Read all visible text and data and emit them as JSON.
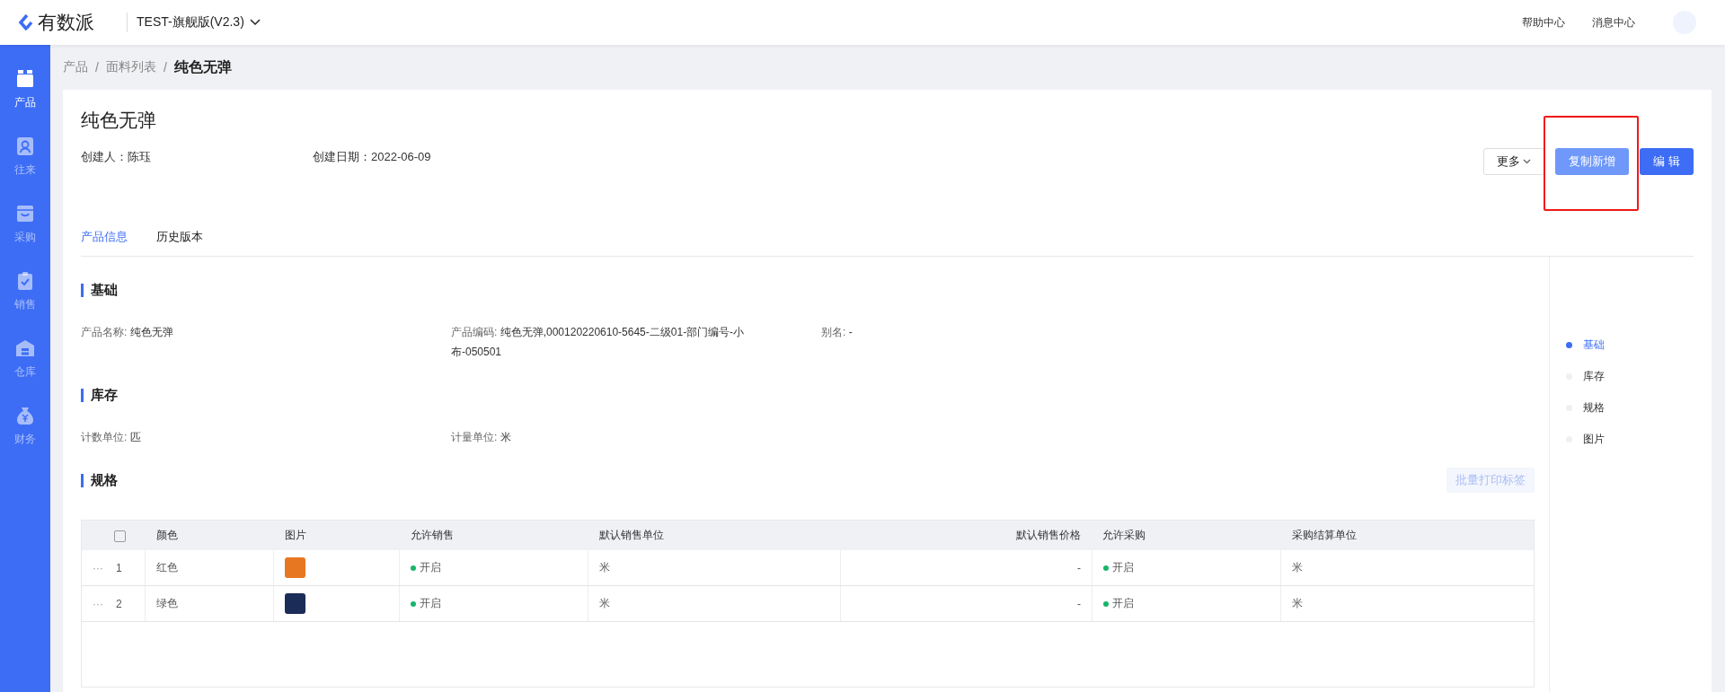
{
  "header": {
    "logo": "有数派",
    "workspace": "TEST-旗舰版(V2.3)",
    "links": [
      "帮助中心",
      "消息中心"
    ]
  },
  "sidebar": {
    "items": [
      {
        "label": "产品",
        "selected": true
      },
      {
        "label": "往来",
        "selected": false
      },
      {
        "label": "采购",
        "selected": false
      },
      {
        "label": "销售",
        "selected": false
      },
      {
        "label": "仓库",
        "selected": false
      },
      {
        "label": "财务",
        "selected": false
      }
    ]
  },
  "breadcrumb": {
    "separator": "/",
    "items": [
      "产品",
      "面料列表",
      "纯色无弹"
    ]
  },
  "title": "纯色无弹",
  "meta": [
    {
      "label": "创建人：",
      "value": "陈珏"
    },
    {
      "label": "创建日期：",
      "value": "2022-06-09"
    }
  ],
  "actions": [
    {
      "label": "更多",
      "kind": "dropdown",
      "highlighted": false
    },
    {
      "label": "复制新增",
      "kind": "light",
      "highlighted": true
    },
    {
      "label": "编 辑",
      "kind": "primary",
      "highlighted": false
    }
  ],
  "tabs": [
    {
      "label": "产品信息",
      "selected": true
    },
    {
      "label": "历史版本",
      "selected": false
    }
  ],
  "sections": [
    {
      "title": "基础",
      "fields": [
        {
          "label": "产品名称: ",
          "value": "纯色无弹"
        },
        {
          "label": "产品编码: ",
          "value": "纯色无弹,000120220610-5645-二级01-部门编号-小布-050501"
        },
        {
          "label": "别名: ",
          "value": "-"
        }
      ]
    },
    {
      "title": "库存",
      "fields": [
        {
          "label": "计数单位: ",
          "value": "匹"
        },
        {
          "label": "计量单位: ",
          "value": "米"
        }
      ]
    }
  ],
  "spec": {
    "title": "规格",
    "print_button": "批量打印标签",
    "table": {
      "select_all": {
        "checked": false
      },
      "columns": [
        "颜色",
        "图片",
        "允许销售",
        "默认销售单位",
        "默认销售价格",
        "允许采购",
        "采购结算单位"
      ],
      "rows": [
        {
          "handle": "···",
          "index": "1",
          "color_name": "红色",
          "thumbnail": {
            "color": "#e87722"
          },
          "allow_sale": {
            "on": true,
            "label": "开启"
          },
          "sale_unit": "米",
          "sale_price": "-",
          "allow_purchase": {
            "on": true,
            "label": "开启"
          },
          "purchase_unit": "米"
        },
        {
          "handle": "···",
          "index": "2",
          "color_name": "绿色",
          "thumbnail": {
            "color": "#1c2c58"
          },
          "allow_sale": {
            "on": true,
            "label": "开启"
          },
          "sale_unit": "米",
          "sale_price": "-",
          "allow_purchase": {
            "on": true,
            "label": "开启"
          },
          "purchase_unit": "米"
        }
      ]
    }
  },
  "anchors": [
    {
      "label": "基础",
      "selected": true
    },
    {
      "label": "库存",
      "selected": false
    },
    {
      "label": "规格",
      "selected": false
    },
    {
      "label": "图片",
      "selected": false
    }
  ]
}
